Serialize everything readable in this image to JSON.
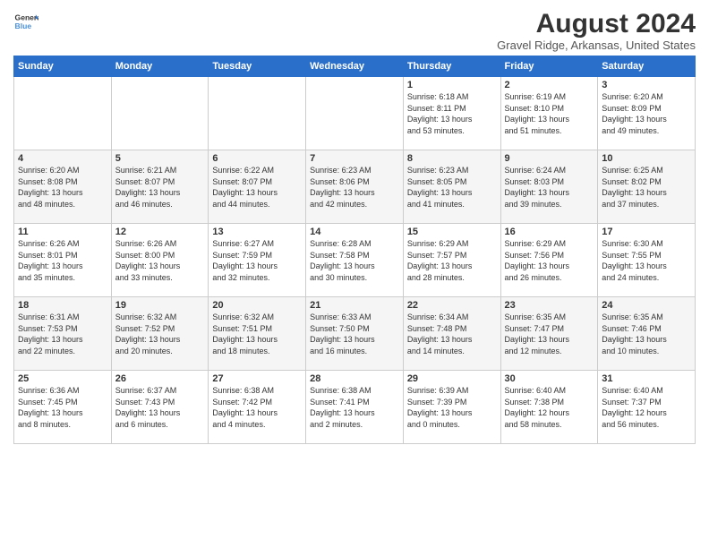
{
  "header": {
    "logo_general": "General",
    "logo_blue": "Blue",
    "title": "August 2024",
    "location": "Gravel Ridge, Arkansas, United States"
  },
  "weekdays": [
    "Sunday",
    "Monday",
    "Tuesday",
    "Wednesday",
    "Thursday",
    "Friday",
    "Saturday"
  ],
  "weeks": [
    [
      {
        "day": "",
        "info": ""
      },
      {
        "day": "",
        "info": ""
      },
      {
        "day": "",
        "info": ""
      },
      {
        "day": "",
        "info": ""
      },
      {
        "day": "1",
        "info": "Sunrise: 6:18 AM\nSunset: 8:11 PM\nDaylight: 13 hours\nand 53 minutes."
      },
      {
        "day": "2",
        "info": "Sunrise: 6:19 AM\nSunset: 8:10 PM\nDaylight: 13 hours\nand 51 minutes."
      },
      {
        "day": "3",
        "info": "Sunrise: 6:20 AM\nSunset: 8:09 PM\nDaylight: 13 hours\nand 49 minutes."
      }
    ],
    [
      {
        "day": "4",
        "info": "Sunrise: 6:20 AM\nSunset: 8:08 PM\nDaylight: 13 hours\nand 48 minutes."
      },
      {
        "day": "5",
        "info": "Sunrise: 6:21 AM\nSunset: 8:07 PM\nDaylight: 13 hours\nand 46 minutes."
      },
      {
        "day": "6",
        "info": "Sunrise: 6:22 AM\nSunset: 8:07 PM\nDaylight: 13 hours\nand 44 minutes."
      },
      {
        "day": "7",
        "info": "Sunrise: 6:23 AM\nSunset: 8:06 PM\nDaylight: 13 hours\nand 42 minutes."
      },
      {
        "day": "8",
        "info": "Sunrise: 6:23 AM\nSunset: 8:05 PM\nDaylight: 13 hours\nand 41 minutes."
      },
      {
        "day": "9",
        "info": "Sunrise: 6:24 AM\nSunset: 8:03 PM\nDaylight: 13 hours\nand 39 minutes."
      },
      {
        "day": "10",
        "info": "Sunrise: 6:25 AM\nSunset: 8:02 PM\nDaylight: 13 hours\nand 37 minutes."
      }
    ],
    [
      {
        "day": "11",
        "info": "Sunrise: 6:26 AM\nSunset: 8:01 PM\nDaylight: 13 hours\nand 35 minutes."
      },
      {
        "day": "12",
        "info": "Sunrise: 6:26 AM\nSunset: 8:00 PM\nDaylight: 13 hours\nand 33 minutes."
      },
      {
        "day": "13",
        "info": "Sunrise: 6:27 AM\nSunset: 7:59 PM\nDaylight: 13 hours\nand 32 minutes."
      },
      {
        "day": "14",
        "info": "Sunrise: 6:28 AM\nSunset: 7:58 PM\nDaylight: 13 hours\nand 30 minutes."
      },
      {
        "day": "15",
        "info": "Sunrise: 6:29 AM\nSunset: 7:57 PM\nDaylight: 13 hours\nand 28 minutes."
      },
      {
        "day": "16",
        "info": "Sunrise: 6:29 AM\nSunset: 7:56 PM\nDaylight: 13 hours\nand 26 minutes."
      },
      {
        "day": "17",
        "info": "Sunrise: 6:30 AM\nSunset: 7:55 PM\nDaylight: 13 hours\nand 24 minutes."
      }
    ],
    [
      {
        "day": "18",
        "info": "Sunrise: 6:31 AM\nSunset: 7:53 PM\nDaylight: 13 hours\nand 22 minutes."
      },
      {
        "day": "19",
        "info": "Sunrise: 6:32 AM\nSunset: 7:52 PM\nDaylight: 13 hours\nand 20 minutes."
      },
      {
        "day": "20",
        "info": "Sunrise: 6:32 AM\nSunset: 7:51 PM\nDaylight: 13 hours\nand 18 minutes."
      },
      {
        "day": "21",
        "info": "Sunrise: 6:33 AM\nSunset: 7:50 PM\nDaylight: 13 hours\nand 16 minutes."
      },
      {
        "day": "22",
        "info": "Sunrise: 6:34 AM\nSunset: 7:48 PM\nDaylight: 13 hours\nand 14 minutes."
      },
      {
        "day": "23",
        "info": "Sunrise: 6:35 AM\nSunset: 7:47 PM\nDaylight: 13 hours\nand 12 minutes."
      },
      {
        "day": "24",
        "info": "Sunrise: 6:35 AM\nSunset: 7:46 PM\nDaylight: 13 hours\nand 10 minutes."
      }
    ],
    [
      {
        "day": "25",
        "info": "Sunrise: 6:36 AM\nSunset: 7:45 PM\nDaylight: 13 hours\nand 8 minutes."
      },
      {
        "day": "26",
        "info": "Sunrise: 6:37 AM\nSunset: 7:43 PM\nDaylight: 13 hours\nand 6 minutes."
      },
      {
        "day": "27",
        "info": "Sunrise: 6:38 AM\nSunset: 7:42 PM\nDaylight: 13 hours\nand 4 minutes."
      },
      {
        "day": "28",
        "info": "Sunrise: 6:38 AM\nSunset: 7:41 PM\nDaylight: 13 hours\nand 2 minutes."
      },
      {
        "day": "29",
        "info": "Sunrise: 6:39 AM\nSunset: 7:39 PM\nDaylight: 13 hours\nand 0 minutes."
      },
      {
        "day": "30",
        "info": "Sunrise: 6:40 AM\nSunset: 7:38 PM\nDaylight: 12 hours\nand 58 minutes."
      },
      {
        "day": "31",
        "info": "Sunrise: 6:40 AM\nSunset: 7:37 PM\nDaylight: 12 hours\nand 56 minutes."
      }
    ]
  ]
}
